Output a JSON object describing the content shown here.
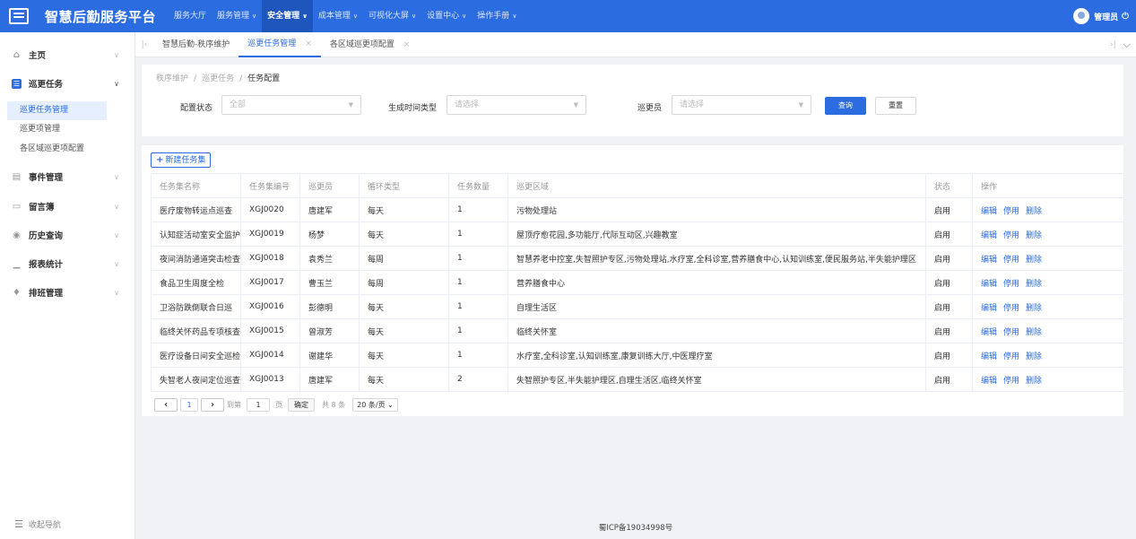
{
  "header": {
    "title": "智慧后勤服务平台",
    "nav": [
      {
        "label": "服务大厅",
        "has_menu": false,
        "active": false
      },
      {
        "label": "服务管理",
        "has_menu": true,
        "active": false
      },
      {
        "label": "安全管理",
        "has_menu": true,
        "active": true
      },
      {
        "label": "成本管理",
        "has_menu": true,
        "active": false
      },
      {
        "label": "可视化大屏",
        "has_menu": true,
        "active": false
      },
      {
        "label": "设置中心",
        "has_menu": true,
        "active": false
      },
      {
        "label": "操作手册",
        "has_menu": true,
        "active": false
      }
    ],
    "user": "管理员",
    "brand_color": "#2b6ce0"
  },
  "sidebar": {
    "items": [
      {
        "label": "主页",
        "icon": "home-icon"
      },
      {
        "label": "巡更任务",
        "icon": "task-icon",
        "open": true
      },
      {
        "label": "事件管理",
        "icon": "event-icon"
      },
      {
        "label": "留言簿",
        "icon": "message-icon"
      },
      {
        "label": "历史查询",
        "icon": "history-icon"
      },
      {
        "label": "报表统计",
        "icon": "chart-icon"
      },
      {
        "label": "排班管理",
        "icon": "bell-icon"
      }
    ],
    "sub_items": [
      "巡更任务管理",
      "巡更项管理",
      "各区域巡更项配置"
    ],
    "collapse_label": "收起导航"
  },
  "tabs": [
    {
      "label": "智慧后勤-秩序维护",
      "closable": false,
      "active": false
    },
    {
      "label": "巡更任务管理",
      "closable": true,
      "active": true
    },
    {
      "label": "各区域巡更项配置",
      "closable": true,
      "active": false
    }
  ],
  "breadcrumb": [
    "秩序维护",
    "巡更任务",
    "任务配置"
  ],
  "filters": {
    "config_status": {
      "label": "配置状态",
      "value": "全部"
    },
    "gen_time_type": {
      "label": "生成时间类型",
      "placeholder": "请选择"
    },
    "patroller": {
      "label": "巡更员",
      "placeholder": "请选择"
    },
    "query_label": "查询",
    "reset_label": "重置"
  },
  "new_button_label": "新建任务集",
  "table": {
    "columns": [
      "任务集名称",
      "任务集编号",
      "巡更员",
      "循环类型",
      "任务数量",
      "巡更区域",
      "状态",
      "操作"
    ],
    "rows": [
      [
        "医疗废物转运点巡查",
        "XGJ0020",
        "唐建军",
        "每天",
        "1",
        "污物处理站",
        "启用"
      ],
      [
        "认知症活动室安全监护",
        "XGJ0019",
        "杨梦",
        "每天",
        "1",
        "屋顶疗愈花园,多功能厅,代际互动区,兴趣教室",
        "启用"
      ],
      [
        "夜间消防通道突击检查",
        "XGJ0018",
        "袁秀兰",
        "每周",
        "1",
        "智慧养老中控室,失智照护专区,污物处理站,水疗室,全科诊室,营养膳食中心,认知训练室,便民服务站,半失能护理区",
        "启用"
      ],
      [
        "食品卫生周度全检",
        "XGJ0017",
        "曹玉兰",
        "每周",
        "1",
        "营养膳食中心",
        "启用"
      ],
      [
        "卫浴防跌倒联合日巡",
        "XGJ0016",
        "彭德明",
        "每天",
        "1",
        "自理生活区",
        "启用"
      ],
      [
        "临终关怀药品专项核查",
        "XGJ0015",
        "曾淑芳",
        "每天",
        "1",
        "临终关怀室",
        "启用"
      ],
      [
        "医疗设备日间安全巡检",
        "XGJ0014",
        "谢建华",
        "每天",
        "1",
        "水疗室,全科诊室,认知训练室,康复训练大厅,中医理疗室",
        "启用"
      ],
      [
        "失智老人夜间定位巡查",
        "XGJ0013",
        "唐建军",
        "每天",
        "2",
        "失智照护专区,半失能护理区,自理生活区,临终关怀室",
        "启用"
      ]
    ],
    "ops": [
      "编辑",
      "停用",
      "删除"
    ]
  },
  "pagination": {
    "current_page": "1",
    "goto_prefix": "到第",
    "goto_value": "1",
    "goto_suffix": "页",
    "confirm_label": "确定",
    "total_label": "共 8 条",
    "page_size": "20 条/页"
  },
  "footer": "蜀ICP备19034998号"
}
